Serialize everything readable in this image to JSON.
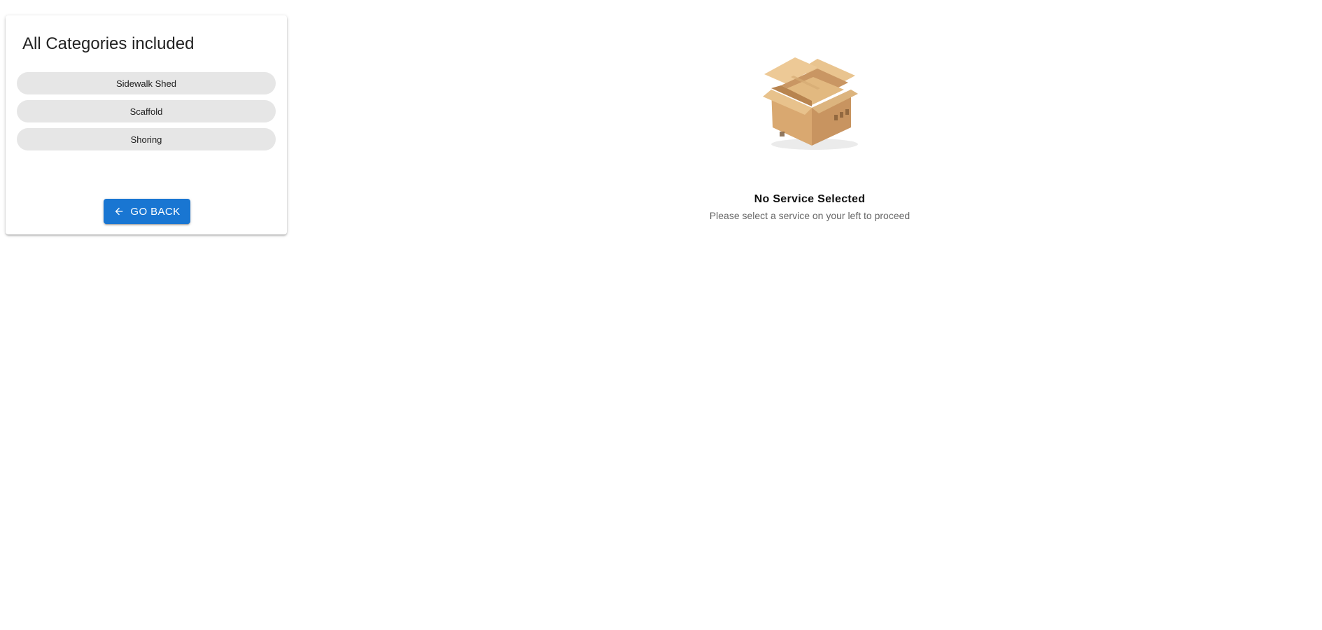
{
  "sidebar": {
    "title": "All Categories included",
    "categories": [
      {
        "label": "Sidewalk Shed"
      },
      {
        "label": "Scaffold"
      },
      {
        "label": "Shoring"
      }
    ],
    "back_button": {
      "label": "GO BACK",
      "icon": "arrow-left-icon",
      "color": "#1976d2"
    }
  },
  "main": {
    "empty_state": {
      "illustration": "open-box-illustration",
      "title": "No Service Selected",
      "subtitle": "Please select a service on your left to proceed"
    }
  }
}
